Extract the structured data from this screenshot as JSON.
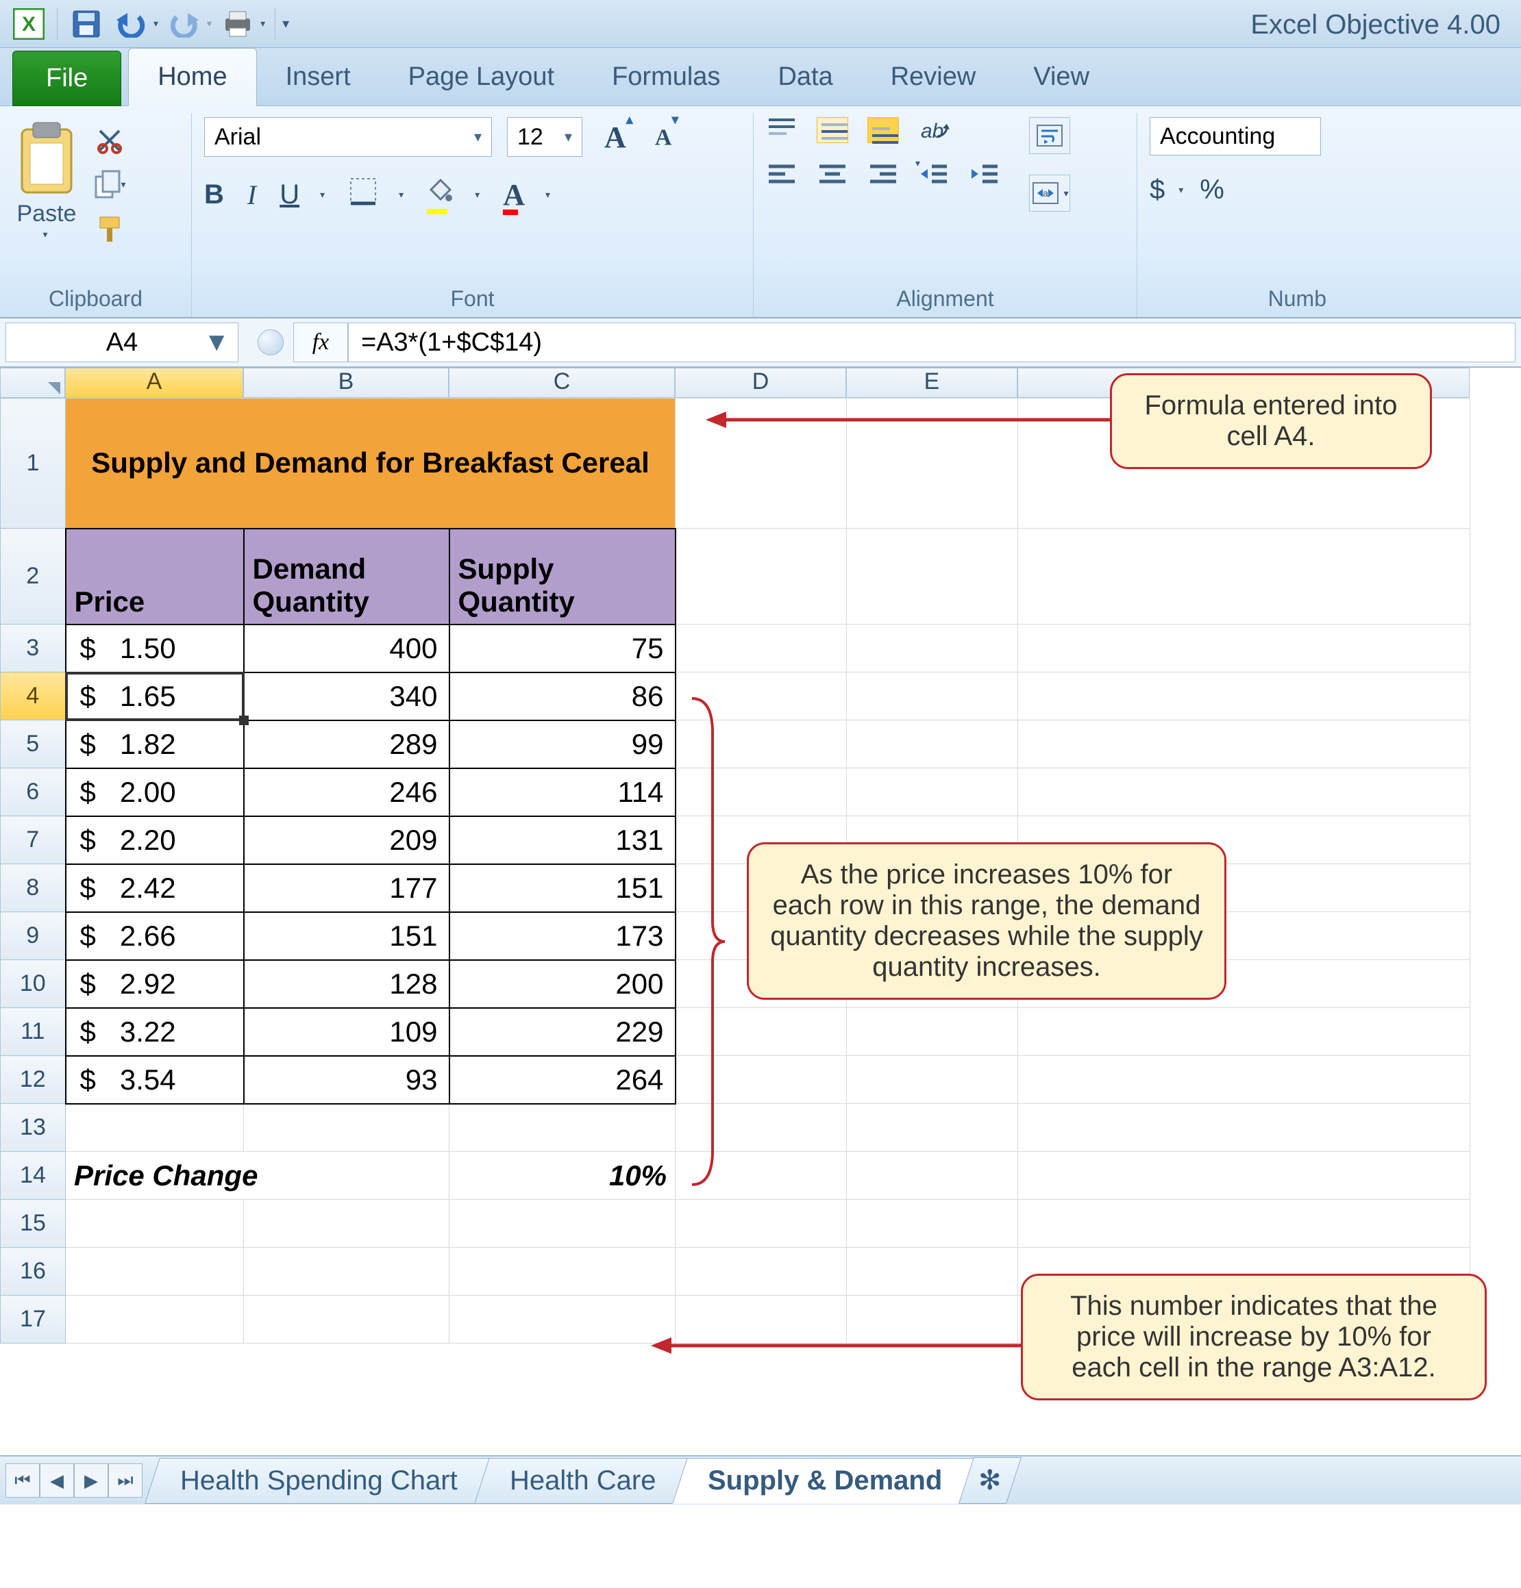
{
  "titlebar": {
    "doc_title": "Excel Objective 4.00"
  },
  "tabs": {
    "file": "File",
    "home": "Home",
    "insert": "Insert",
    "page_layout": "Page Layout",
    "formulas": "Formulas",
    "data": "Data",
    "review": "Review",
    "view": "View"
  },
  "ribbon": {
    "clipboard": {
      "paste": "Paste",
      "label": "Clipboard"
    },
    "font": {
      "name": "Arial",
      "size": "12",
      "label": "Font",
      "bold": "B",
      "italic": "I",
      "underline": "U"
    },
    "alignment": {
      "label": "Alignment"
    },
    "number": {
      "format": "Accounting",
      "label": "Numb",
      "currency": "$",
      "percent": "%"
    }
  },
  "formula_bar": {
    "name_box": "A4",
    "fx": "fx",
    "formula": "=A3*(1+$C$14)"
  },
  "columns": [
    "A",
    "B",
    "C",
    "D",
    "E"
  ],
  "sheet": {
    "title": "Supply and Demand for Breakfast Cereal",
    "headers": {
      "a": "Price",
      "b": "Demand Quantity",
      "c": "Supply Quantity"
    },
    "rows": [
      {
        "price": "$   1.50",
        "demand": "400",
        "supply": "75"
      },
      {
        "price": "$   1.65",
        "demand": "340",
        "supply": "86"
      },
      {
        "price": "$   1.82",
        "demand": "289",
        "supply": "99"
      },
      {
        "price": "$   2.00",
        "demand": "246",
        "supply": "114"
      },
      {
        "price": "$   2.20",
        "demand": "209",
        "supply": "131"
      },
      {
        "price": "$   2.42",
        "demand": "177",
        "supply": "151"
      },
      {
        "price": "$   2.66",
        "demand": "151",
        "supply": "173"
      },
      {
        "price": "$   2.92",
        "demand": "128",
        "supply": "200"
      },
      {
        "price": "$   3.22",
        "demand": "109",
        "supply": "229"
      },
      {
        "price": "$   3.54",
        "demand": "93",
        "supply": "264"
      }
    ],
    "price_change_label": "Price Change",
    "price_change_value": "10%"
  },
  "sheet_tabs": {
    "t1": "Health Spending Chart",
    "t2": "Health Care",
    "t3": "Supply & Demand"
  },
  "callouts": {
    "c1": "Formula entered into cell A4.",
    "c2": "As the price increases 10% for each row in this range, the demand quantity decreases while the supply quantity increases.",
    "c3": "This number indicates that the price will increase by 10% for each cell in the range A3:A12."
  },
  "chart_data": {
    "type": "table",
    "title": "Supply and Demand for Breakfast Cereal",
    "columns": [
      "Price",
      "Demand Quantity",
      "Supply Quantity"
    ],
    "rows": [
      [
        1.5,
        400,
        75
      ],
      [
        1.65,
        340,
        86
      ],
      [
        1.82,
        289,
        99
      ],
      [
        2.0,
        246,
        114
      ],
      [
        2.2,
        209,
        131
      ],
      [
        2.42,
        177,
        151
      ],
      [
        2.66,
        151,
        173
      ],
      [
        2.92,
        128,
        200
      ],
      [
        3.22,
        109,
        229
      ],
      [
        3.54,
        93,
        264
      ]
    ],
    "parameters": {
      "Price Change": "10%"
    },
    "formula_A4": "=A3*(1+$C$14)"
  }
}
